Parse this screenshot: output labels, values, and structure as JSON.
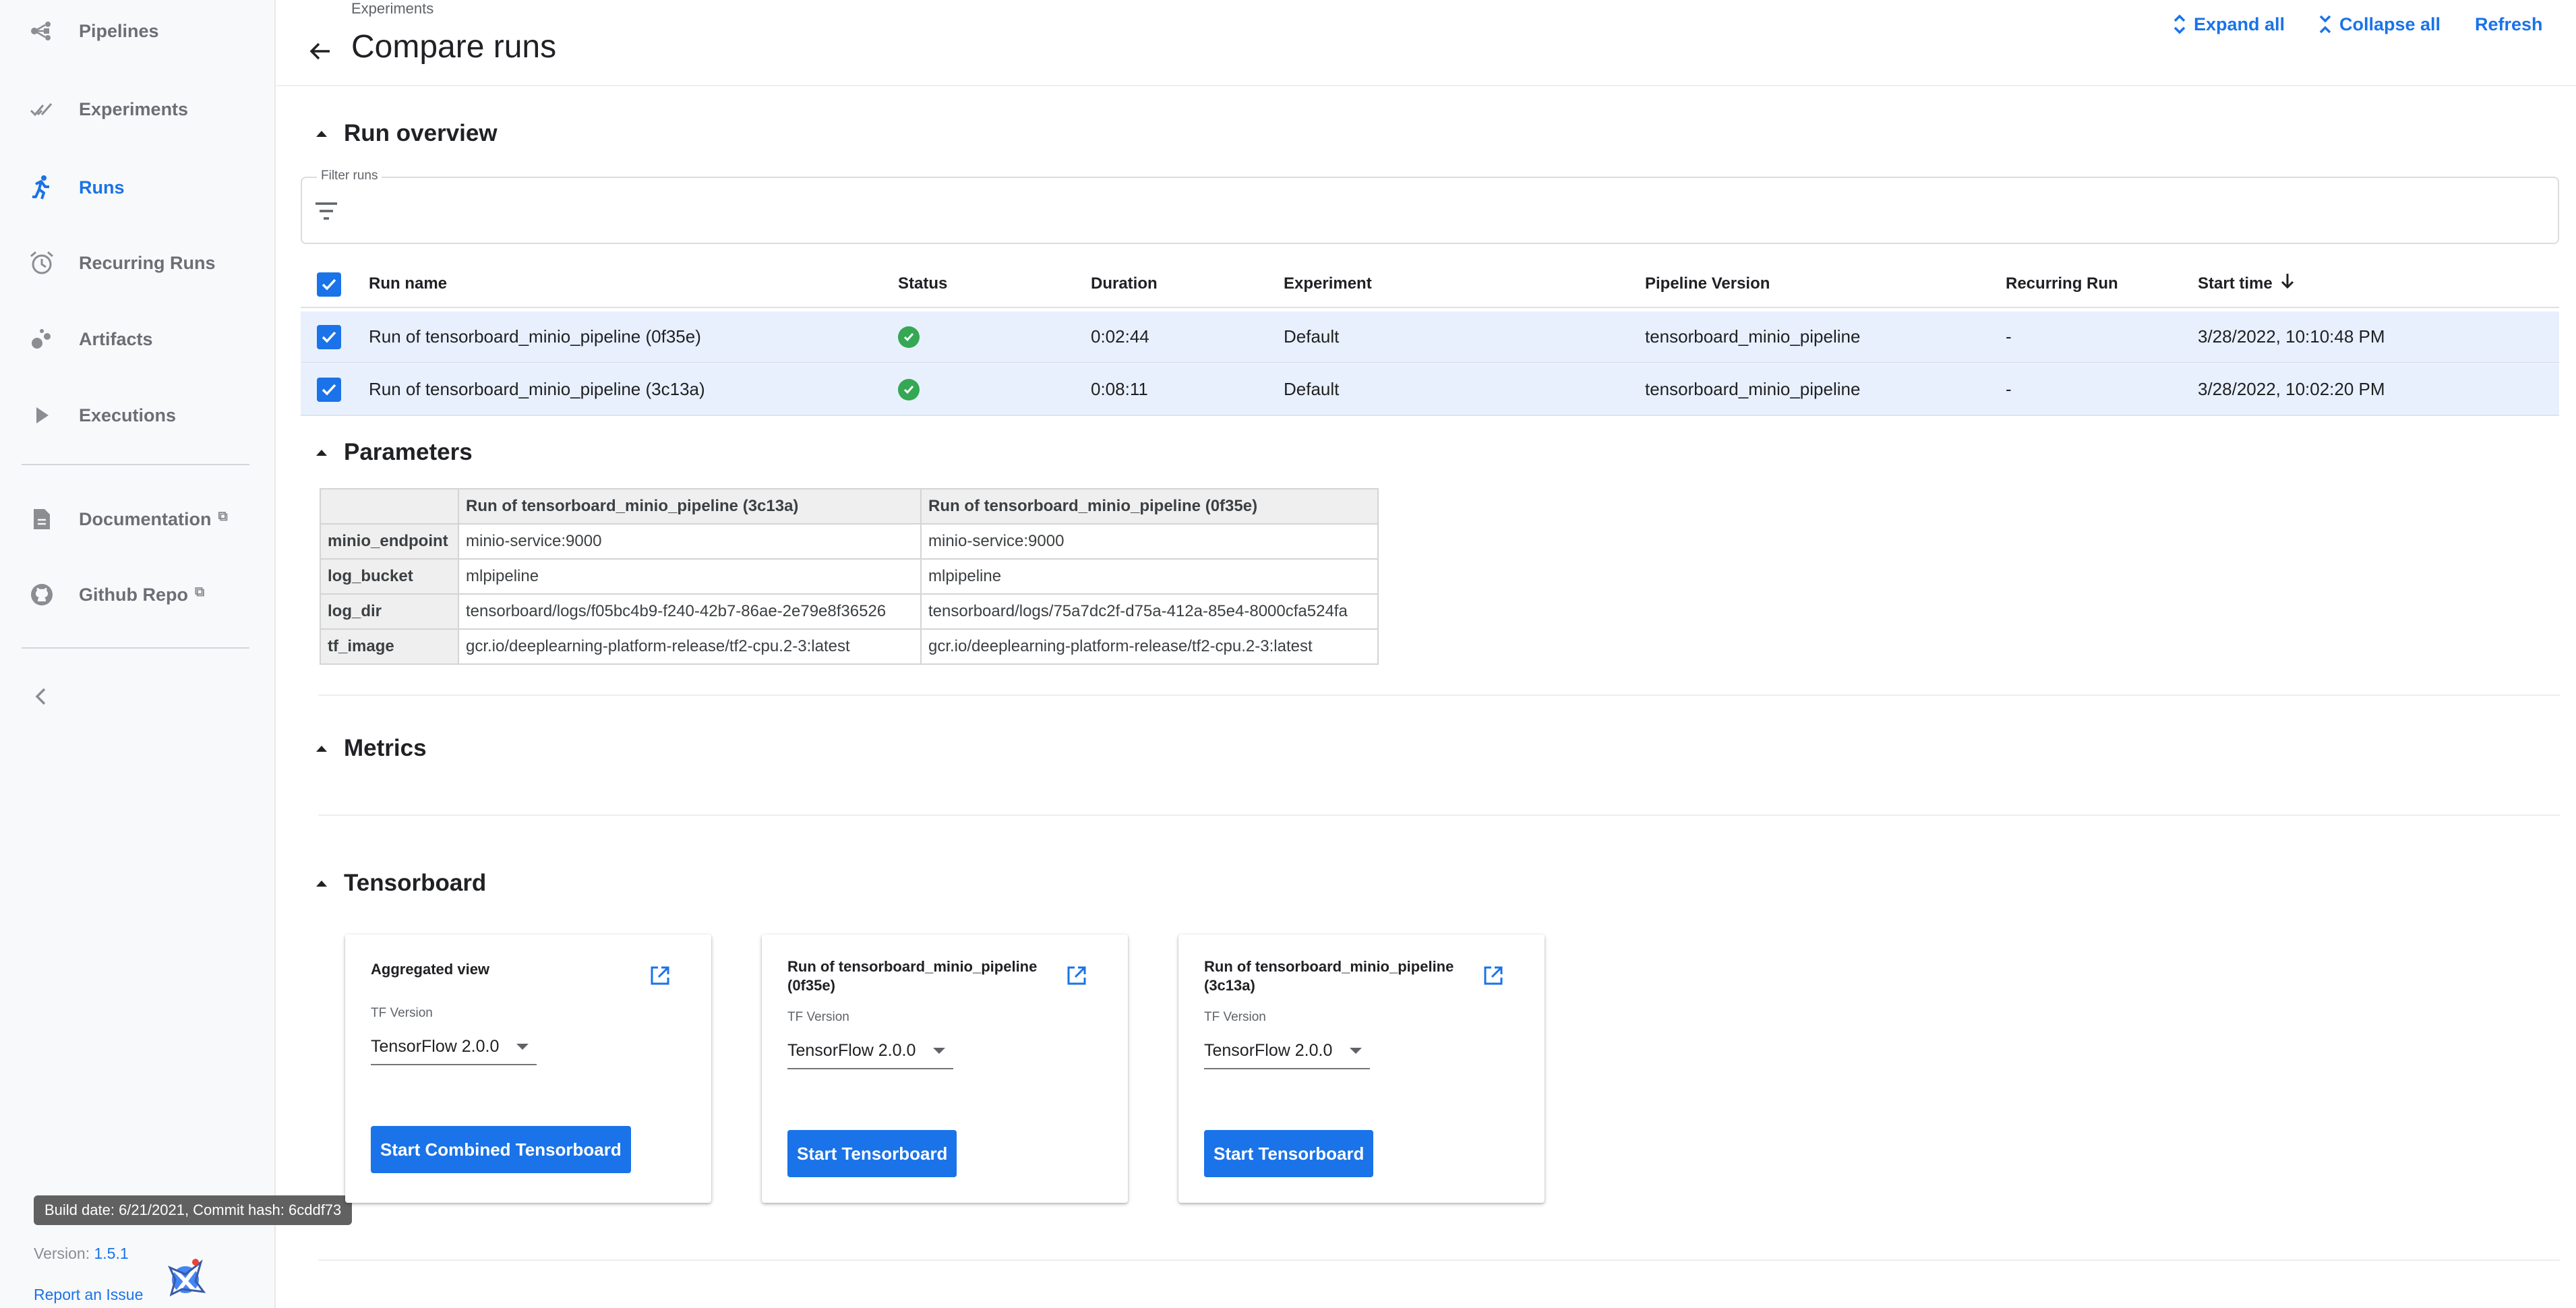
{
  "sidebar": {
    "items": [
      {
        "label": "Pipelines",
        "icon": "pipelines-icon",
        "active": false
      },
      {
        "label": "Experiments",
        "icon": "experiments-icon",
        "active": false
      },
      {
        "label": "Runs",
        "icon": "runs-icon",
        "active": true
      },
      {
        "label": "Recurring Runs",
        "icon": "alarm-clock-icon",
        "active": false
      },
      {
        "label": "Artifacts",
        "icon": "artifacts-icon",
        "active": false
      },
      {
        "label": "Executions",
        "icon": "play-icon",
        "active": false
      }
    ],
    "links": [
      {
        "label": "Documentation",
        "icon": "document-icon"
      },
      {
        "label": "Github Repo",
        "icon": "github-icon"
      }
    ],
    "build_info": "Build date: 6/21/2021, Commit hash: 6cddf73",
    "version_label": "Version: ",
    "version_value": "1.5.1",
    "report_issue": "Report an Issue"
  },
  "header": {
    "breadcrumb": "Experiments",
    "title": "Compare runs",
    "expand_all": "Expand all",
    "collapse_all": "Collapse all",
    "refresh": "Refresh"
  },
  "run_overview": {
    "title": "Run overview",
    "filter_label": "Filter runs",
    "filter_value": "",
    "columns": [
      "Run name",
      "Status",
      "Duration",
      "Experiment",
      "Pipeline Version",
      "Recurring Run",
      "Start time"
    ],
    "sort_column": "Start time",
    "rows": [
      {
        "name": "Run of tensorboard_minio_pipeline (0f35e)",
        "status": "succeeded",
        "duration": "0:02:44",
        "experiment": "Default",
        "pipeline_version": "tensorboard_minio_pipeline",
        "recurring_run": "-",
        "start_time": "3/28/2022, 10:10:48 PM"
      },
      {
        "name": "Run of tensorboard_minio_pipeline (3c13a)",
        "status": "succeeded",
        "duration": "0:08:11",
        "experiment": "Default",
        "pipeline_version": "tensorboard_minio_pipeline",
        "recurring_run": "-",
        "start_time": "3/28/2022, 10:02:20 PM"
      }
    ]
  },
  "parameters": {
    "title": "Parameters",
    "header": [
      "",
      "Run of tensorboard_minio_pipeline (3c13a)",
      "Run of tensorboard_minio_pipeline (0f35e)"
    ],
    "rows": [
      [
        "minio_endpoint",
        "minio-service:9000",
        "minio-service:9000"
      ],
      [
        "log_bucket",
        "mlpipeline",
        "mlpipeline"
      ],
      [
        "log_dir",
        "tensorboard/logs/f05bc4b9-f240-42b7-86ae-2e79e8f36526",
        "tensorboard/logs/75a7dc2f-d75a-412a-85e4-8000cfa524fa"
      ],
      [
        "tf_image",
        "gcr.io/deeplearning-platform-release/tf2-cpu.2-3:latest",
        "gcr.io/deeplearning-platform-release/tf2-cpu.2-3:latest"
      ]
    ]
  },
  "metrics": {
    "title": "Metrics"
  },
  "tensorboard": {
    "title": "Tensorboard",
    "cards": [
      {
        "title": "Aggregated view",
        "tf_label": "TF Version",
        "tf_version": "TensorFlow 2.0.0",
        "button": "Start Combined Tensorboard"
      },
      {
        "title": "Run of tensorboard_minio_pipeline (0f35e)",
        "tf_label": "TF Version",
        "tf_version": "TensorFlow 2.0.0",
        "button": "Start Tensorboard"
      },
      {
        "title": "Run of tensorboard_minio_pipeline (3c13a)",
        "tf_label": "TF Version",
        "tf_version": "TensorFlow 2.0.0",
        "button": "Start Tensorboard"
      }
    ]
  },
  "colors": {
    "accent": "#1a73e8",
    "selected_row": "#e8f0fe",
    "success": "#34a853",
    "sidebar_bg": "#f8f9fa"
  }
}
